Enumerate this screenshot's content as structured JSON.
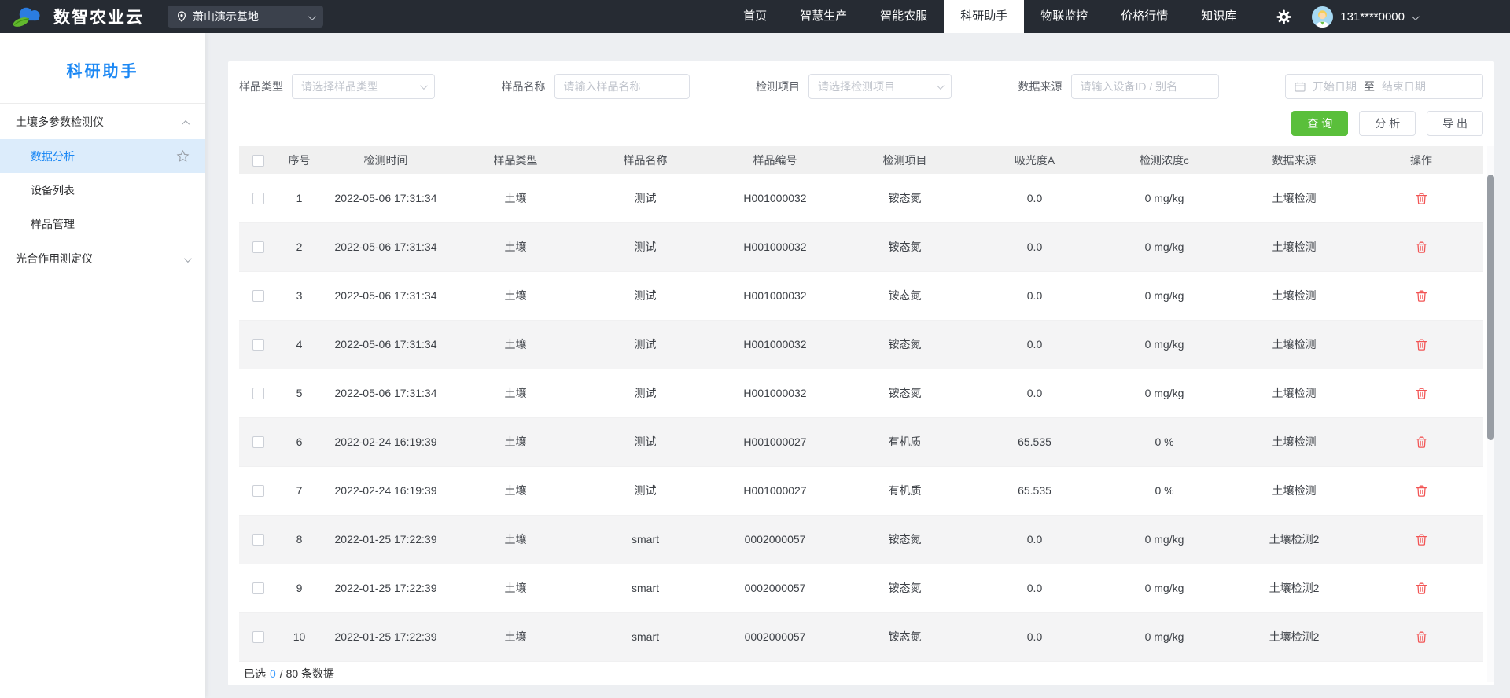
{
  "colors": {
    "navbar_bg": "#262b33",
    "accent_blue": "#1a87f4",
    "primary_green": "#5abf3b",
    "danger_red": "#f25555",
    "active_item_bg": "#dcecfb",
    "count_blue": "#409eff"
  },
  "icons": {
    "logo": "cloud-leaf",
    "location": "map-pin",
    "settings": "gear",
    "calendar": "calendar",
    "favorite": "star-outline",
    "delete": "trash",
    "collapse": "chevron-up",
    "expand": "chevron-down"
  },
  "navbar": {
    "brand": "数智农业云",
    "base_selector": {
      "value": "萧山演示基地"
    },
    "items": [
      {
        "label": "首页"
      },
      {
        "label": "智慧生产"
      },
      {
        "label": "智能农服"
      },
      {
        "label": "科研助手",
        "active": true
      },
      {
        "label": "物联监控"
      },
      {
        "label": "价格行情"
      },
      {
        "label": "知识库"
      }
    ],
    "user": {
      "phone": "131****0000"
    }
  },
  "sidebar": {
    "title": "科研助手",
    "groups": [
      {
        "label": "土壤多参数检测仪",
        "expanded": true,
        "children": [
          {
            "label": "数据分析",
            "active": true
          },
          {
            "label": "设备列表"
          },
          {
            "label": "样品管理"
          }
        ]
      },
      {
        "label": "光合作用测定仪",
        "expanded": false,
        "children": []
      }
    ]
  },
  "filters": {
    "sample_type": {
      "label": "样品类型",
      "placeholder": "请选择样品类型"
    },
    "sample_name": {
      "label": "样品名称",
      "placeholder": "请输入样品名称"
    },
    "test_item": {
      "label": "检测项目",
      "placeholder": "请选择检测项目"
    },
    "data_source": {
      "label": "数据来源",
      "placeholder": "请输入设备ID / 别名"
    },
    "date_range": {
      "start_placeholder": "开始日期",
      "separator": "至",
      "end_placeholder": "结束日期"
    }
  },
  "actions": {
    "query": "查 询",
    "analyze": "分 析",
    "export": "导 出"
  },
  "table": {
    "columns": [
      "序号",
      "检测时间",
      "样品类型",
      "样品名称",
      "样品编号",
      "检测项目",
      "吸光度A",
      "检测浓度c",
      "数据来源",
      "操作"
    ],
    "rows": [
      {
        "index": "1",
        "time": "2022-05-06 17:31:34",
        "type": "土壤",
        "name": "测试",
        "code": "H001000032",
        "item": "铵态氮",
        "absorbance": "0.0",
        "concentration": "0 mg/kg",
        "source": "土壤检测"
      },
      {
        "index": "2",
        "time": "2022-05-06 17:31:34",
        "type": "土壤",
        "name": "测试",
        "code": "H001000032",
        "item": "铵态氮",
        "absorbance": "0.0",
        "concentration": "0 mg/kg",
        "source": "土壤检测"
      },
      {
        "index": "3",
        "time": "2022-05-06 17:31:34",
        "type": "土壤",
        "name": "测试",
        "code": "H001000032",
        "item": "铵态氮",
        "absorbance": "0.0",
        "concentration": "0 mg/kg",
        "source": "土壤检测"
      },
      {
        "index": "4",
        "time": "2022-05-06 17:31:34",
        "type": "土壤",
        "name": "测试",
        "code": "H001000032",
        "item": "铵态氮",
        "absorbance": "0.0",
        "concentration": "0 mg/kg",
        "source": "土壤检测"
      },
      {
        "index": "5",
        "time": "2022-05-06 17:31:34",
        "type": "土壤",
        "name": "测试",
        "code": "H001000032",
        "item": "铵态氮",
        "absorbance": "0.0",
        "concentration": "0 mg/kg",
        "source": "土壤检测"
      },
      {
        "index": "6",
        "time": "2022-02-24 16:19:39",
        "type": "土壤",
        "name": "测试",
        "code": "H001000027",
        "item": "有机质",
        "absorbance": "65.535",
        "concentration": "0 %",
        "source": "土壤检测"
      },
      {
        "index": "7",
        "time": "2022-02-24 16:19:39",
        "type": "土壤",
        "name": "测试",
        "code": "H001000027",
        "item": "有机质",
        "absorbance": "65.535",
        "concentration": "0 %",
        "source": "土壤检测"
      },
      {
        "index": "8",
        "time": "2022-01-25 17:22:39",
        "type": "土壤",
        "name": "smart",
        "code": "0002000057",
        "item": "铵态氮",
        "absorbance": "0.0",
        "concentration": "0 mg/kg",
        "source": "土壤检测2"
      },
      {
        "index": "9",
        "time": "2022-01-25 17:22:39",
        "type": "土壤",
        "name": "smart",
        "code": "0002000057",
        "item": "铵态氮",
        "absorbance": "0.0",
        "concentration": "0 mg/kg",
        "source": "土壤检测2"
      },
      {
        "index": "10",
        "time": "2022-01-25 17:22:39",
        "type": "土壤",
        "name": "smart",
        "code": "0002000057",
        "item": "铵态氮",
        "absorbance": "0.0",
        "concentration": "0 mg/kg",
        "source": "土壤检测2"
      }
    ]
  },
  "footer": {
    "selected_prefix": "已选",
    "selected_count": "0",
    "total_suffix": "/ 80 条数据"
  }
}
